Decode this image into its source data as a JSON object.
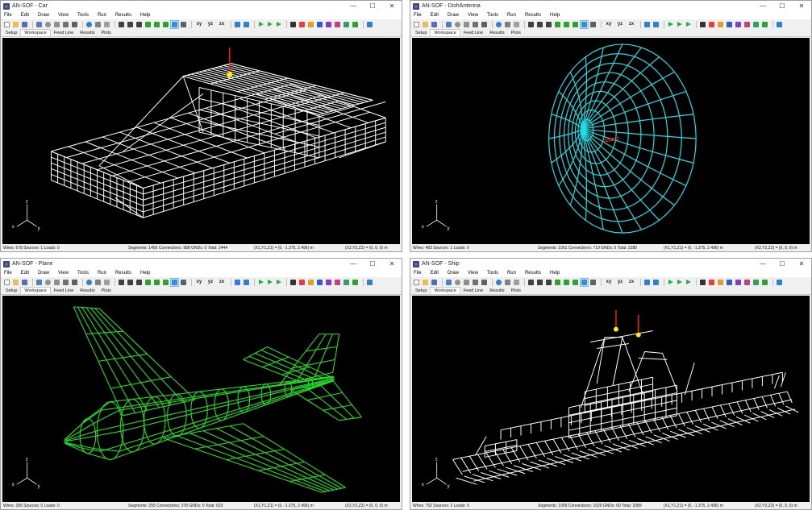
{
  "common": {
    "menu": [
      "File",
      "Edit",
      "Draw",
      "View",
      "Tools",
      "Run",
      "Results",
      "Help"
    ],
    "tabs": [
      "Setup",
      "Workspace",
      "Feed Line",
      "Results",
      "Plots"
    ],
    "toolbar_text": [
      "xy",
      "yz",
      "zx"
    ],
    "controls": {
      "min": "—",
      "max": "☐",
      "close": "✕"
    },
    "axis_labels": {
      "x": "x",
      "y": "y",
      "z": "z"
    }
  },
  "windows": [
    {
      "title": "AN-SOF - Car",
      "status": {
        "wires": "Wires: 678  Sources: 1  Loads: 0",
        "segments": "Segments: 1456  Connections: 988  GNDs: 0  Total: 2444",
        "p1": "(X1,Y1,Z1) = (0, -1.375, 2.496) m",
        "p2": "(X2,Y2,Z2) = (0, 0, 0) m"
      },
      "wire_color": "#ffffff"
    },
    {
      "title": "AN-SOF - DishAntenna",
      "status": {
        "wires": "Wires: 483  Sources: 1  Loads: 0",
        "segments": "Segments: 1561  Connections: 719  GNDs: 0  Total: 2280",
        "p1": "(X1,Y1,Z1) = (0, -1.375, 2.496) m",
        "p2": "(X2,Y2,Z2) = (0, 0, 0) m"
      },
      "wire_color": "#22e0e8"
    },
    {
      "title": "AN-SOF - Plane",
      "status": {
        "wires": "Wires: 356  Sources: 0  Loads: 0",
        "segments": "Segments: 255  Connections: 378  GNDs: 0  Total: 633",
        "p1": "(X1,Y1,Z1) = (0, -1.375, 2.496) m",
        "p2": "(X2,Y2,Z2) = (0, 0, 0) m"
      },
      "wire_color": "#22e022"
    },
    {
      "title": "AN-SOF - Ship",
      "status": {
        "wires": "Wires: 752  Sources: 2  Loads: 0",
        "segments": "Segments: 1009  Connections: 1020  GNDs: 60  Total: 2089",
        "p1": "(X1,Y1,Z1) = (0, -1.375, 2.496) m",
        "p2": "(X2,Y2,Z2) = (0, 0, 0) m"
      },
      "wire_color": "#ffffff"
    }
  ],
  "colors": {
    "viewport_bg": "#000000",
    "source_marker": "#ffee00",
    "source_line": "#ff1a1a"
  }
}
